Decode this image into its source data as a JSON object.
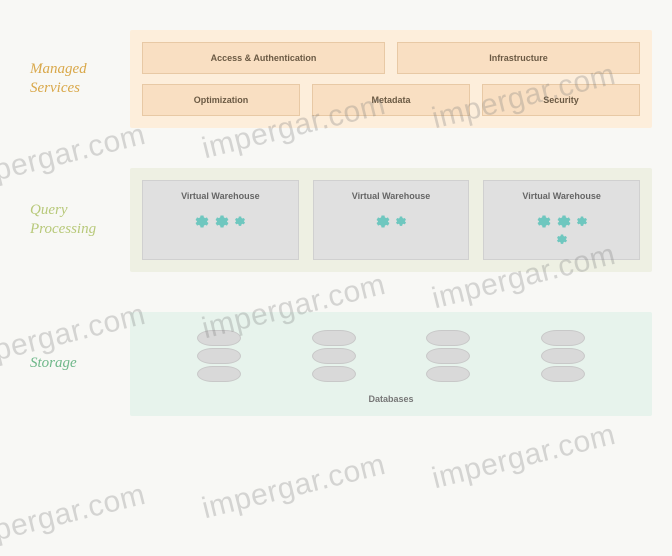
{
  "layers": {
    "managed": {
      "label": "Managed Services",
      "row1": [
        "Access & Authentication",
        "Infrastructure"
      ],
      "row2": [
        "Optimization",
        "Metadata",
        "Security"
      ]
    },
    "query": {
      "label": "Query Processing",
      "boxes": [
        "Virtual Warehouse",
        "Virtual Warehouse",
        "Virtual Warehouse"
      ]
    },
    "storage": {
      "label": "Storage",
      "caption": "Databases"
    }
  },
  "watermark": "impergar.com"
}
